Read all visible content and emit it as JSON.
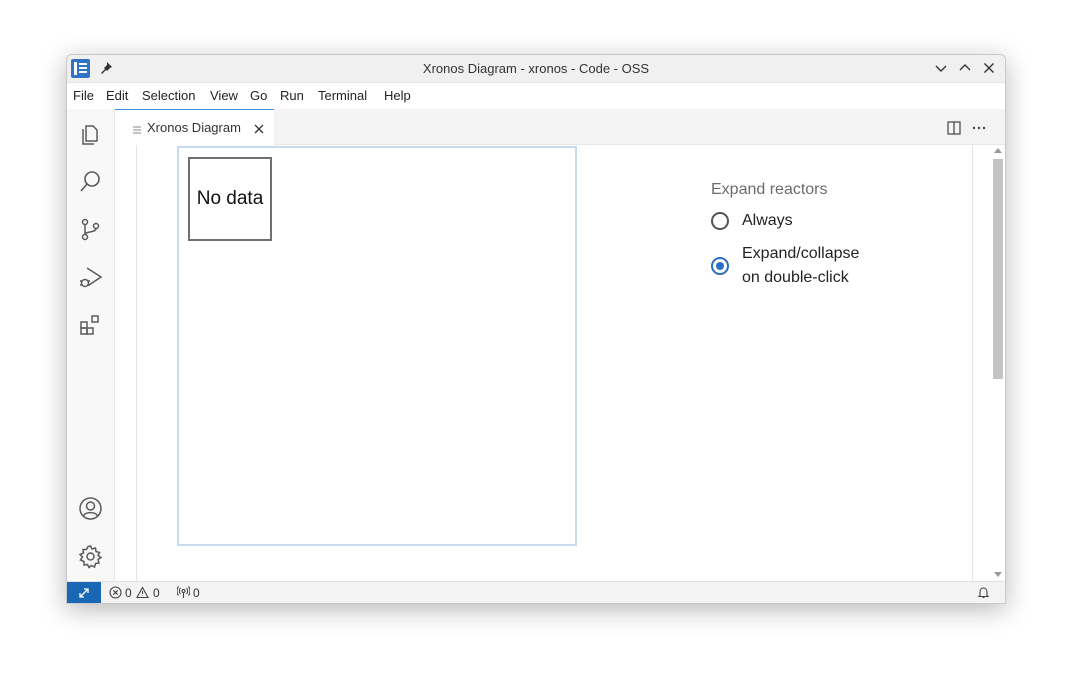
{
  "window": {
    "title": "Xronos Diagram - xronos - Code - OSS"
  },
  "menu": {
    "items": [
      "File",
      "Edit",
      "Selection",
      "View",
      "Go",
      "Run",
      "Terminal",
      "Help"
    ]
  },
  "activity_bar": {
    "top": [
      "files-icon",
      "search-icon",
      "source-control-icon",
      "run-debug-icon",
      "extensions-icon"
    ],
    "bottom": [
      "account-icon",
      "settings-gear-icon"
    ]
  },
  "tabs": [
    {
      "label": "Xronos Diagram",
      "active": true
    }
  ],
  "editor": {
    "placeholder": "No data",
    "options": {
      "heading": "Expand reactors",
      "radios": [
        {
          "label": "Always",
          "checked": false
        },
        {
          "label_line1": "Expand/collapse",
          "label_line2": "on double-click",
          "checked": true
        }
      ]
    }
  },
  "status_bar": {
    "errors": "0",
    "warnings": "0",
    "ports": "0"
  },
  "colors": {
    "accent": "#2b6ec5",
    "remote": "#1a68b4",
    "app_icon": "#2e74c8",
    "frame": "#c7dcf3"
  }
}
